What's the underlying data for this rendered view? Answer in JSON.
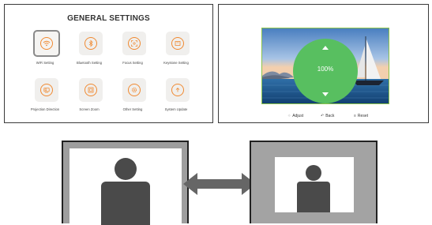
{
  "settings_panel": {
    "title": "GENERAL SETTINGS",
    "accent_color": "#f08a32",
    "items": [
      {
        "label": "WiFi Setting",
        "icon": "wifi-icon",
        "selected": true
      },
      {
        "label": "Bluetooth Setting",
        "icon": "bluetooth-icon",
        "selected": false
      },
      {
        "label": "Focus Setting",
        "icon": "focus-icon",
        "selected": false
      },
      {
        "label": "Keystone Setting",
        "icon": "keystone-icon",
        "selected": false
      },
      {
        "label": "Projection Direction",
        "icon": "projection-icon",
        "selected": false
      },
      {
        "label": "Screen Zoom",
        "icon": "screen-zoom-icon",
        "selected": false
      },
      {
        "label": "Other Setting",
        "icon": "gear-icon",
        "selected": false
      },
      {
        "label": "System Update",
        "icon": "update-icon",
        "selected": false
      }
    ]
  },
  "zoom_panel": {
    "value": "100%",
    "dial_color": "#58bf60",
    "hints": [
      {
        "label": "Adjust",
        "icon": "dpad-icon"
      },
      {
        "label": "Back",
        "icon": "back-icon"
      },
      {
        "label": "Reset",
        "icon": "menu-icon"
      }
    ]
  },
  "diagram": {
    "left_screen": "full",
    "right_screen": "zoomed-out"
  }
}
